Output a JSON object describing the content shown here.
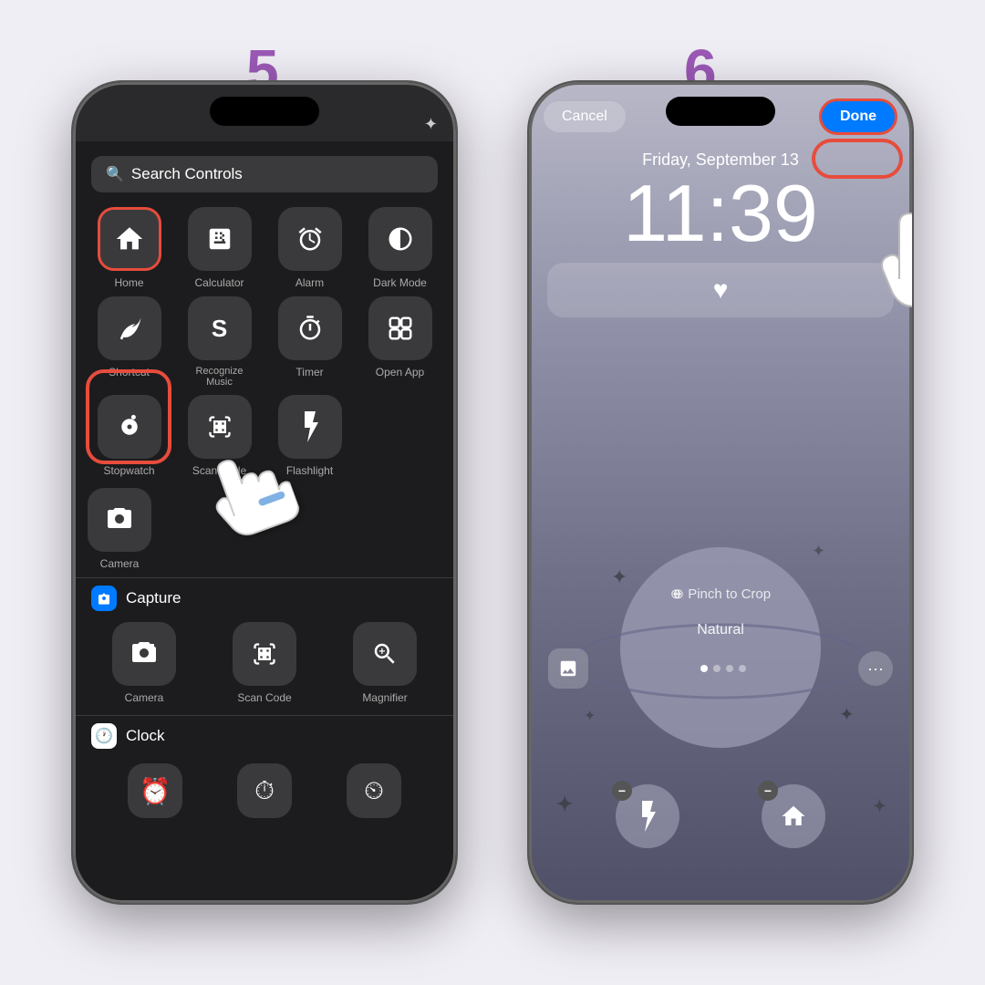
{
  "steps": {
    "step5": {
      "number": "5",
      "search_placeholder": "Search Controls",
      "controls": [
        {
          "label": "Home",
          "icon": "🏠",
          "highlighted": true
        },
        {
          "label": "Calculator",
          "icon": "🔢",
          "highlighted": false
        },
        {
          "label": "Alarm",
          "icon": "⏰",
          "highlighted": false
        },
        {
          "label": "Dark Mode",
          "icon": "◑",
          "highlighted": false
        },
        {
          "label": "Shortcut",
          "icon": "◈",
          "highlighted": false
        },
        {
          "label": "Recognize Music",
          "icon": "𝅘𝅥𝅮",
          "highlighted": false
        },
        {
          "label": "Timer",
          "icon": "⏱",
          "highlighted": false
        },
        {
          "label": "Open App",
          "icon": "⊞",
          "highlighted": false
        },
        {
          "label": "Stopwatch",
          "icon": "⏱",
          "highlighted": false
        },
        {
          "label": "Scan Code",
          "icon": "⊡",
          "highlighted": false
        },
        {
          "label": "Flashlight",
          "icon": "🔦",
          "highlighted": false
        },
        {
          "label": "Camera",
          "icon": "📷",
          "highlighted": false
        }
      ],
      "capture_section": "Capture",
      "capture_items": [
        {
          "label": "Camera",
          "icon": "📷"
        },
        {
          "label": "Scan Code",
          "icon": "⊡"
        },
        {
          "label": "Magnifier",
          "icon": "🔍"
        }
      ],
      "clock_section": "Clock"
    },
    "step6": {
      "number": "6",
      "cancel_label": "Cancel",
      "done_label": "Done",
      "date": "Friday, September 13",
      "time": "11:39",
      "pinch_label": "⊕ Pinch to Crop",
      "natural_label": "Natural",
      "flashlight_icon": "🔦",
      "home_icon": "🏠"
    }
  },
  "colors": {
    "accent_purple": "#9b59b6",
    "red_highlight": "#e74c3c",
    "ios_blue": "#007AFF",
    "dark_bg": "#1c1c1e",
    "card_bg": "#3a3a3c"
  }
}
